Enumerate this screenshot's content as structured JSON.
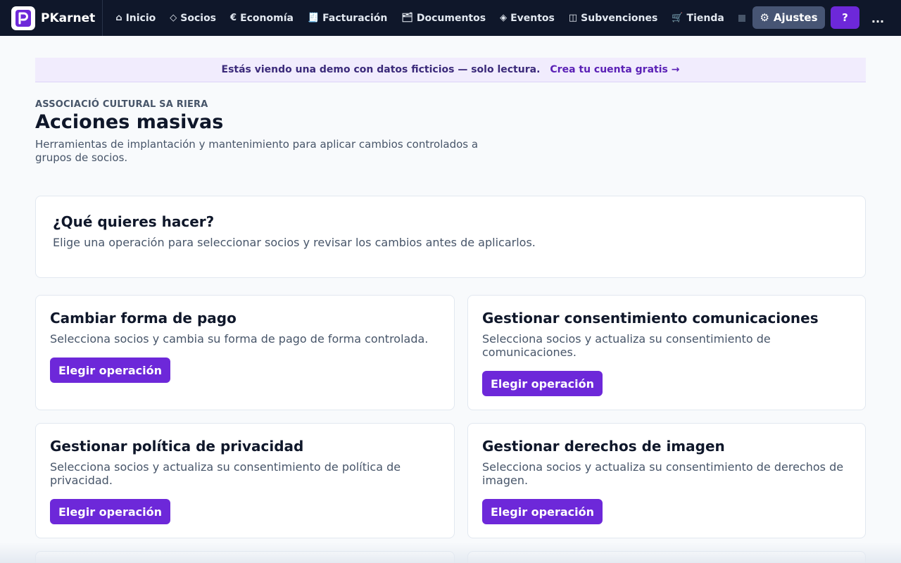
{
  "app": {
    "name": "PKarnet"
  },
  "nav": {
    "items": [
      {
        "label": "Inicio",
        "icon": "⌂",
        "icon_name": "home-icon"
      },
      {
        "label": "Socios",
        "icon": "◇",
        "icon_name": "members-icon"
      },
      {
        "label": "Economía",
        "icon": "€",
        "icon_name": "euro-icon"
      },
      {
        "label": "Facturación",
        "icon": "🧾",
        "icon_name": "invoice-icon"
      },
      {
        "label": "Documentos",
        "icon": "🗂",
        "icon_name": "folder-icon"
      },
      {
        "label": "Eventos",
        "icon": "◈",
        "icon_name": "events-icon"
      },
      {
        "label": "Subvenciones",
        "icon": "◫",
        "icon_name": "grants-icon"
      },
      {
        "label": "Tienda",
        "icon": "🛒",
        "icon_name": "cart-icon"
      }
    ],
    "settings_label": "Ajustes",
    "settings_icon": "⚙",
    "help_label": "?",
    "more_label": "..."
  },
  "banner": {
    "text": "Estás viendo una demo con datos ficticios — solo lectura.",
    "link": "Crea tu cuenta gratis →"
  },
  "header": {
    "org": "ASSOCIACIÓ CULTURAL SA RIERA",
    "title": "Acciones masivas",
    "subtitle": "Herramientas de implantación y mantenimiento para aplicar cambios controlados a grupos de socios."
  },
  "intro": {
    "title": "¿Qué quieres hacer?",
    "text": "Elige una operación para seleccionar socios y revisar los cambios antes de aplicarlos."
  },
  "operations": [
    {
      "title": "Cambiar forma de pago",
      "description": "Selecciona socios y cambia su forma de pago de forma controlada.",
      "button": "Elegir operación"
    },
    {
      "title": "Gestionar consentimiento comunicaciones",
      "description": "Selecciona socios y actualiza su consentimiento de comunicaciones.",
      "button": "Elegir operación"
    },
    {
      "title": "Gestionar política de privacidad",
      "description": "Selecciona socios y actualiza su consentimiento de política de privacidad.",
      "button": "Elegir operación"
    },
    {
      "title": "Gestionar derechos de imagen",
      "description": "Selecciona socios y actualiza su consentimiento de derechos de imagen.",
      "button": "Elegir operación"
    }
  ],
  "colors": {
    "nav_bg": "#0f172a",
    "accent": "#6d28d9",
    "banner_bg": "#f1ecfd",
    "settings_bg": "#475574"
  }
}
